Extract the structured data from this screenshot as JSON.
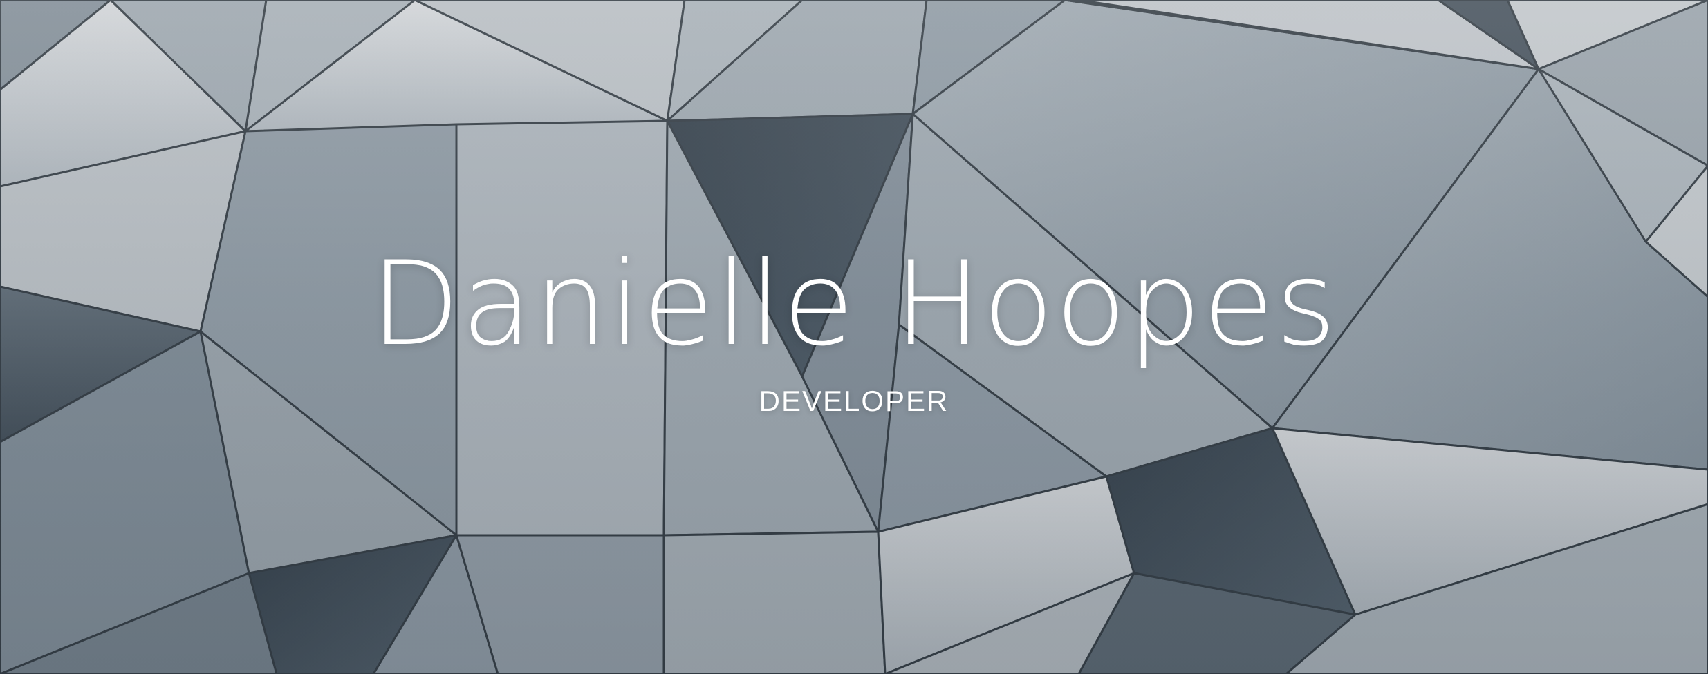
{
  "hero": {
    "name": "Danielle Hoopes",
    "role": "DEVELOPER"
  },
  "background": {
    "description_icon": "geometric-triangle-facade-image",
    "palette": {
      "light": "#c9cdd1",
      "mid": "#8d99a3",
      "dark": "#3d4a55",
      "shadow": "#1f2a33",
      "text": "#ffffff"
    }
  }
}
